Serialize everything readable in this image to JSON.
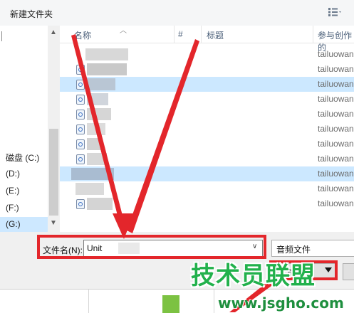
{
  "toolbar": {
    "new_folder": "新建文件夹",
    "view_icon": "view-options-icon"
  },
  "nav": {
    "items": [
      {
        "label": "磁盘 (C:)",
        "selected": false
      },
      {
        "label": "(D:)",
        "selected": false
      },
      {
        "label": "(E:)",
        "selected": false
      },
      {
        "label": "(F:)",
        "selected": false
      },
      {
        "label": "(G:)",
        "selected": true
      }
    ]
  },
  "list": {
    "columns": {
      "name": "名称",
      "number": "#",
      "title": "标题",
      "contributing_artist": "参与创作的"
    },
    "rows": [
      {
        "author": "tailuowan"
      },
      {
        "author": "tailuowan"
      },
      {
        "author": "tailuowan"
      },
      {
        "author": "tailuowan"
      },
      {
        "author": "tailuowan"
      },
      {
        "author": "tailuowan"
      },
      {
        "author": "tailuowan"
      },
      {
        "author": "tailuowan"
      },
      {
        "author": "tailuowan"
      },
      {
        "author": "tailuowan"
      },
      {
        "author": "tailuowan"
      }
    ]
  },
  "bottom": {
    "filename_label": "文件名(N):",
    "filename_value": "Unit",
    "filetype_value": "音频文件",
    "tools_label": "工具(L)"
  },
  "colors": {
    "annotation": "#e3262b",
    "selection": "#cce8ff",
    "watermark": "#22b14c"
  },
  "watermark": {
    "text": "技术员联盟",
    "url": "www.jsgho.com"
  }
}
